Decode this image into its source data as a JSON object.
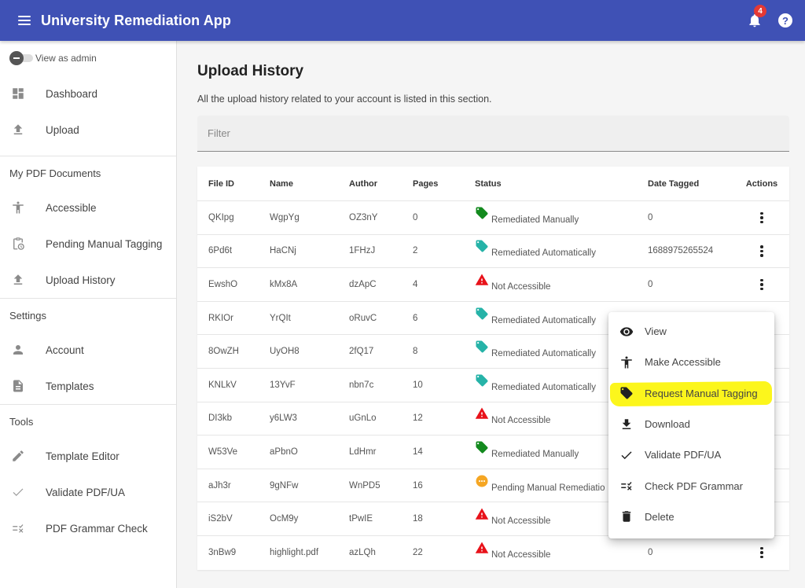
{
  "app": {
    "title": "University Remediation App",
    "notifications_count": "4",
    "help_label": "?"
  },
  "sidebar": {
    "admin_toggle_label": "View as admin",
    "top_items": [
      {
        "label": "Dashboard",
        "icon": "dashboard-icon"
      },
      {
        "label": "Upload",
        "icon": "upload-icon"
      }
    ],
    "sections": [
      {
        "heading": "My PDF Documents",
        "items": [
          {
            "label": "Accessible",
            "icon": "accessibility-icon"
          },
          {
            "label": "Pending Manual Tagging",
            "icon": "pending-clipboard-icon"
          },
          {
            "label": "Upload History",
            "icon": "upload-icon"
          }
        ]
      },
      {
        "heading": "Settings",
        "items": [
          {
            "label": "Account",
            "icon": "person-icon"
          },
          {
            "label": "Templates",
            "icon": "document-icon"
          }
        ]
      },
      {
        "heading": "Tools",
        "items": [
          {
            "label": "Template Editor",
            "icon": "pencil-icon"
          },
          {
            "label": "Validate PDF/UA",
            "icon": "check-icon"
          },
          {
            "label": "PDF Grammar Check",
            "icon": "grammar-check-icon"
          }
        ]
      }
    ]
  },
  "main": {
    "title": "Upload History",
    "subtitle": "All the upload history related to your account is listed in this section.",
    "filter": {
      "placeholder": "Filter",
      "value": ""
    },
    "table": {
      "columns": [
        "File ID",
        "Name",
        "Author",
        "Pages",
        "Status",
        "Date Tagged",
        "Actions"
      ],
      "rows": [
        {
          "file_id": "QKIpg",
          "name": "WgpYg",
          "author": "OZ3nY",
          "pages": "0",
          "status": "Remediated Manually",
          "status_type": "manual",
          "date_tagged": "0"
        },
        {
          "file_id": "6Pd6t",
          "name": "HaCNj",
          "author": "1FHzJ",
          "pages": "2",
          "status": "Remediated Automatically",
          "status_type": "auto",
          "date_tagged": "1688975265524"
        },
        {
          "file_id": "EwshO",
          "name": "kMx8A",
          "author": "dzApC",
          "pages": "4",
          "status": "Not Accessible",
          "status_type": "error",
          "date_tagged": "0"
        },
        {
          "file_id": "RKIOr",
          "name": "YrQIt",
          "author": "oRuvC",
          "pages": "6",
          "status": "Remediated Automatically",
          "status_type": "auto",
          "date_tagged": ""
        },
        {
          "file_id": "8OwZH",
          "name": "UyOH8",
          "author": "2fQ17",
          "pages": "8",
          "status": "Remediated Automatically",
          "status_type": "auto",
          "date_tagged": ""
        },
        {
          "file_id": "KNLkV",
          "name": "13YvF",
          "author": "nbn7c",
          "pages": "10",
          "status": "Remediated Automatically",
          "status_type": "auto",
          "date_tagged": ""
        },
        {
          "file_id": "DI3kb",
          "name": "y6LW3",
          "author": "uGnLo",
          "pages": "12",
          "status": "Not Accessible",
          "status_type": "error",
          "date_tagged": ""
        },
        {
          "file_id": "W53Ve",
          "name": "aPbnO",
          "author": "LdHmr",
          "pages": "14",
          "status": "Remediated Manually",
          "status_type": "manual",
          "date_tagged": ""
        },
        {
          "file_id": "aJh3r",
          "name": "9gNFw",
          "author": "WnPD5",
          "pages": "16",
          "status": "Pending Manual Remediation",
          "status_type": "pending",
          "date_tagged": ""
        },
        {
          "file_id": "iS2bV",
          "name": "OcM9y",
          "author": "tPwIE",
          "pages": "18",
          "status": "Not Accessible",
          "status_type": "error",
          "date_tagged": ""
        },
        {
          "file_id": "3nBw9",
          "name": "highlight.pdf",
          "author": "azLQh",
          "pages": "22",
          "status": "Not Accessible",
          "status_type": "error",
          "date_tagged": "0"
        }
      ]
    }
  },
  "context_menu": {
    "items": [
      {
        "label": "View",
        "icon": "eye-icon"
      },
      {
        "label": "Make Accessible",
        "icon": "accessibility-icon"
      },
      {
        "label": "Request Manual Tagging",
        "icon": "tag-icon",
        "highlighted": true
      },
      {
        "label": "Download",
        "icon": "download-icon"
      },
      {
        "label": "Validate PDF/UA",
        "icon": "check-icon"
      },
      {
        "label": "Check PDF Grammar",
        "icon": "grammar-check-icon"
      },
      {
        "label": "Delete",
        "icon": "trash-icon"
      }
    ]
  },
  "colors": {
    "primary": "#3f51b5",
    "badge": "#e53935",
    "status_manual": "#138a1e",
    "status_auto": "#26b3a8",
    "status_error": "#e8121a",
    "status_pending": "#f5a623",
    "highlight": "#fcf61c"
  }
}
